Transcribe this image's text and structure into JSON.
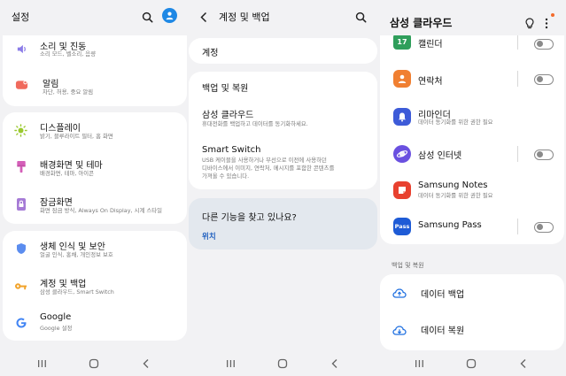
{
  "settings": {
    "title": "설정",
    "items": [
      {
        "title": "소리 및 진동",
        "sub": "소리 모드, 벨소리, 음량",
        "icon": "speaker-icon",
        "color": "#8b7ce8"
      },
      {
        "title": "알림",
        "sub": "차단, 허용, 중요 알림",
        "icon": "notification-icon",
        "color": "#f06a5d"
      },
      {
        "title": "디스플레이",
        "sub": "밝기, 블루라이트 필터, 홈 화면",
        "icon": "sun-icon",
        "color": "#9ac92e"
      },
      {
        "title": "배경화면 및 테마",
        "sub": "배경화면, 테마, 아이콘",
        "icon": "paintbrush-icon",
        "color": "#d45fb8"
      },
      {
        "title": "잠금화면",
        "sub": "화면 잠금 방식, Always On Display, 시계 스타일",
        "icon": "lock-screen-icon",
        "color": "#a67bd6"
      },
      {
        "title": "생체 인식 및 보안",
        "sub": "얼굴 인식, 홍채, 개인정보 보호",
        "icon": "shield-icon",
        "color": "#5b8def"
      },
      {
        "title": "계정 및 백업",
        "sub": "삼성 클라우드, Smart Switch",
        "icon": "key-icon",
        "color": "#f2a42d"
      },
      {
        "title": "Google",
        "sub": "Google 설정",
        "icon": "google-icon",
        "color": "#4285f4"
      }
    ]
  },
  "accounts": {
    "title": "계정 및 백업",
    "account_label": "계정",
    "items": [
      {
        "title": "백업 및 복원",
        "sub": ""
      },
      {
        "title": "삼성 클라우드",
        "sub": "휴대전화를 백업하고 데이터를 동기화하세요."
      },
      {
        "title": "Smart Switch",
        "sub_lines": [
          "USB 케이블을 사용하거나 무선으로 이전에 사용하던",
          "디바이스에서 이미지, 연락처, 메시지를 포함한 콘텐츠를",
          "가져올 수 있습니다."
        ]
      }
    ],
    "suggestion": {
      "question": "다른 기능을 찾고 있나요?",
      "link": "위치",
      "link_color": "#1f5fbf"
    }
  },
  "cloud": {
    "title": "삼성 클라우드",
    "apps": [
      {
        "name": "캘린더",
        "sub": "",
        "icon": "calendar-icon",
        "icon_text": "17",
        "color": "#2f9e5b",
        "toggle": true
      },
      {
        "name": "연락처",
        "sub": "",
        "icon": "contacts-icon",
        "color": "#f07f31",
        "toggle": true
      },
      {
        "name": "리마인더",
        "sub": "데이터 동기화를 위한 권한 필요",
        "icon": "reminder-bell-icon",
        "color": "#3d5bd8",
        "toggle": false
      },
      {
        "name": "삼성 인터넷",
        "sub": "",
        "icon": "internet-icon",
        "color": "#6a50e0",
        "toggle": true
      },
      {
        "name": "Samsung Notes",
        "sub": "데이터 동기화를 위한 권한 필요",
        "icon": "notes-icon",
        "color": "#e8412f",
        "toggle": false
      },
      {
        "name": "Samsung Pass",
        "sub": "",
        "icon": "samsung-pass-icon",
        "icon_text": "Pass",
        "color": "#1e5bd6",
        "toggle": true
      }
    ],
    "section_header": "백업 및 복원",
    "backup_items": [
      {
        "label": "데이터 백업",
        "icon": "cloud-upload-icon"
      },
      {
        "label": "데이터 복원",
        "icon": "cloud-download-icon"
      }
    ],
    "accent_color": "#1f6fe0",
    "badge_color": "#f36b2b"
  }
}
